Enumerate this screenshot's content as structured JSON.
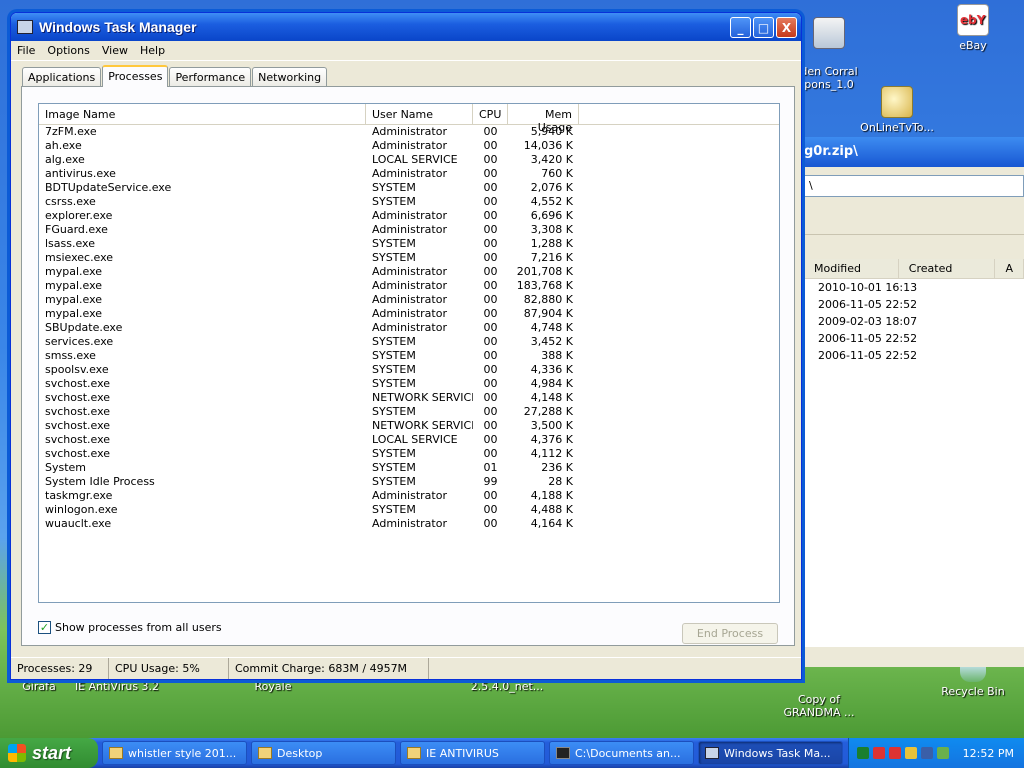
{
  "window": {
    "title": "Windows Task Manager",
    "buttons": [
      "_",
      "□",
      "X"
    ]
  },
  "menu": [
    "File",
    "Options",
    "View",
    "Help"
  ],
  "tabs": [
    "Applications",
    "Processes",
    "Performance",
    "Networking"
  ],
  "active_tab": "Processes",
  "columns": [
    "Image Name",
    "User Name",
    "CPU",
    "Mem Usage"
  ],
  "processes": [
    {
      "name": "7zFM.exe",
      "user": "Administrator",
      "cpu": "00",
      "mem": "5,940 K"
    },
    {
      "name": "ah.exe",
      "user": "Administrator",
      "cpu": "00",
      "mem": "14,036 K"
    },
    {
      "name": "alg.exe",
      "user": "LOCAL SERVICE",
      "cpu": "00",
      "mem": "3,420 K"
    },
    {
      "name": "antivirus.exe",
      "user": "Administrator",
      "cpu": "00",
      "mem": "760 K"
    },
    {
      "name": "BDTUpdateService.exe",
      "user": "SYSTEM",
      "cpu": "00",
      "mem": "2,076 K"
    },
    {
      "name": "csrss.exe",
      "user": "SYSTEM",
      "cpu": "00",
      "mem": "4,552 K"
    },
    {
      "name": "explorer.exe",
      "user": "Administrator",
      "cpu": "00",
      "mem": "6,696 K"
    },
    {
      "name": "FGuard.exe",
      "user": "Administrator",
      "cpu": "00",
      "mem": "3,308 K"
    },
    {
      "name": "lsass.exe",
      "user": "SYSTEM",
      "cpu": "00",
      "mem": "1,288 K"
    },
    {
      "name": "msiexec.exe",
      "user": "SYSTEM",
      "cpu": "00",
      "mem": "7,216 K"
    },
    {
      "name": "mypal.exe",
      "user": "Administrator",
      "cpu": "00",
      "mem": "201,708 K"
    },
    {
      "name": "mypal.exe",
      "user": "Administrator",
      "cpu": "00",
      "mem": "183,768 K"
    },
    {
      "name": "mypal.exe",
      "user": "Administrator",
      "cpu": "00",
      "mem": "82,880 K"
    },
    {
      "name": "mypal.exe",
      "user": "Administrator",
      "cpu": "00",
      "mem": "87,904 K"
    },
    {
      "name": "SBUpdate.exe",
      "user": "Administrator",
      "cpu": "00",
      "mem": "4,748 K"
    },
    {
      "name": "services.exe",
      "user": "SYSTEM",
      "cpu": "00",
      "mem": "3,452 K"
    },
    {
      "name": "smss.exe",
      "user": "SYSTEM",
      "cpu": "00",
      "mem": "388 K"
    },
    {
      "name": "spoolsv.exe",
      "user": "SYSTEM",
      "cpu": "00",
      "mem": "4,336 K"
    },
    {
      "name": "svchost.exe",
      "user": "SYSTEM",
      "cpu": "00",
      "mem": "4,984 K"
    },
    {
      "name": "svchost.exe",
      "user": "NETWORK SERVICE",
      "cpu": "00",
      "mem": "4,148 K"
    },
    {
      "name": "svchost.exe",
      "user": "SYSTEM",
      "cpu": "00",
      "mem": "27,288 K"
    },
    {
      "name": "svchost.exe",
      "user": "NETWORK SERVICE",
      "cpu": "00",
      "mem": "3,500 K"
    },
    {
      "name": "svchost.exe",
      "user": "LOCAL SERVICE",
      "cpu": "00",
      "mem": "4,376 K"
    },
    {
      "name": "svchost.exe",
      "user": "SYSTEM",
      "cpu": "00",
      "mem": "4,112 K"
    },
    {
      "name": "System",
      "user": "SYSTEM",
      "cpu": "01",
      "mem": "236 K"
    },
    {
      "name": "System Idle Process",
      "user": "SYSTEM",
      "cpu": "99",
      "mem": "28 K"
    },
    {
      "name": "taskmgr.exe",
      "user": "Administrator",
      "cpu": "00",
      "mem": "4,188 K"
    },
    {
      "name": "winlogon.exe",
      "user": "SYSTEM",
      "cpu": "00",
      "mem": "4,488 K"
    },
    {
      "name": "wuauclt.exe",
      "user": "Administrator",
      "cpu": "00",
      "mem": "4,164 K"
    }
  ],
  "show_all_label": "Show processes from all users",
  "show_all_checked": true,
  "end_process_label": "End Process",
  "status": {
    "processes": "Processes: 29",
    "cpu": "CPU Usage: 5%",
    "commit": "Commit Charge: 683M / 4957M"
  },
  "desktop_icons": {
    "ebay": "eBay",
    "coral": "den Corral\npons_1.0",
    "onlinetv": "OnLineTvTo...",
    "girafa": "Girafa",
    "ieav": "IE AntiVirus 3.2",
    "royale": "Royale",
    "net": "2.5.4.0_net...",
    "grandma": "Copy of\nGRANDMA ...",
    "recycle": "Recycle Bin"
  },
  "background_window": {
    "title": "g0r.zip\\",
    "address": "\\",
    "columns": [
      "Modified",
      "Created",
      "A"
    ],
    "rows": [
      "2010-10-01 16:13",
      "2006-11-05 22:52",
      "2009-02-03 18:07",
      "2006-11-05 22:52",
      "2006-11-05 22:52"
    ]
  },
  "taskbar": {
    "start": "start",
    "buttons": [
      "whistler style 201...",
      "Desktop",
      "IE ANTIVIRUS",
      "C:\\Documents an...",
      "Windows Task Ma..."
    ],
    "active": "Windows Task Ma...",
    "clock": "12:52 PM"
  }
}
